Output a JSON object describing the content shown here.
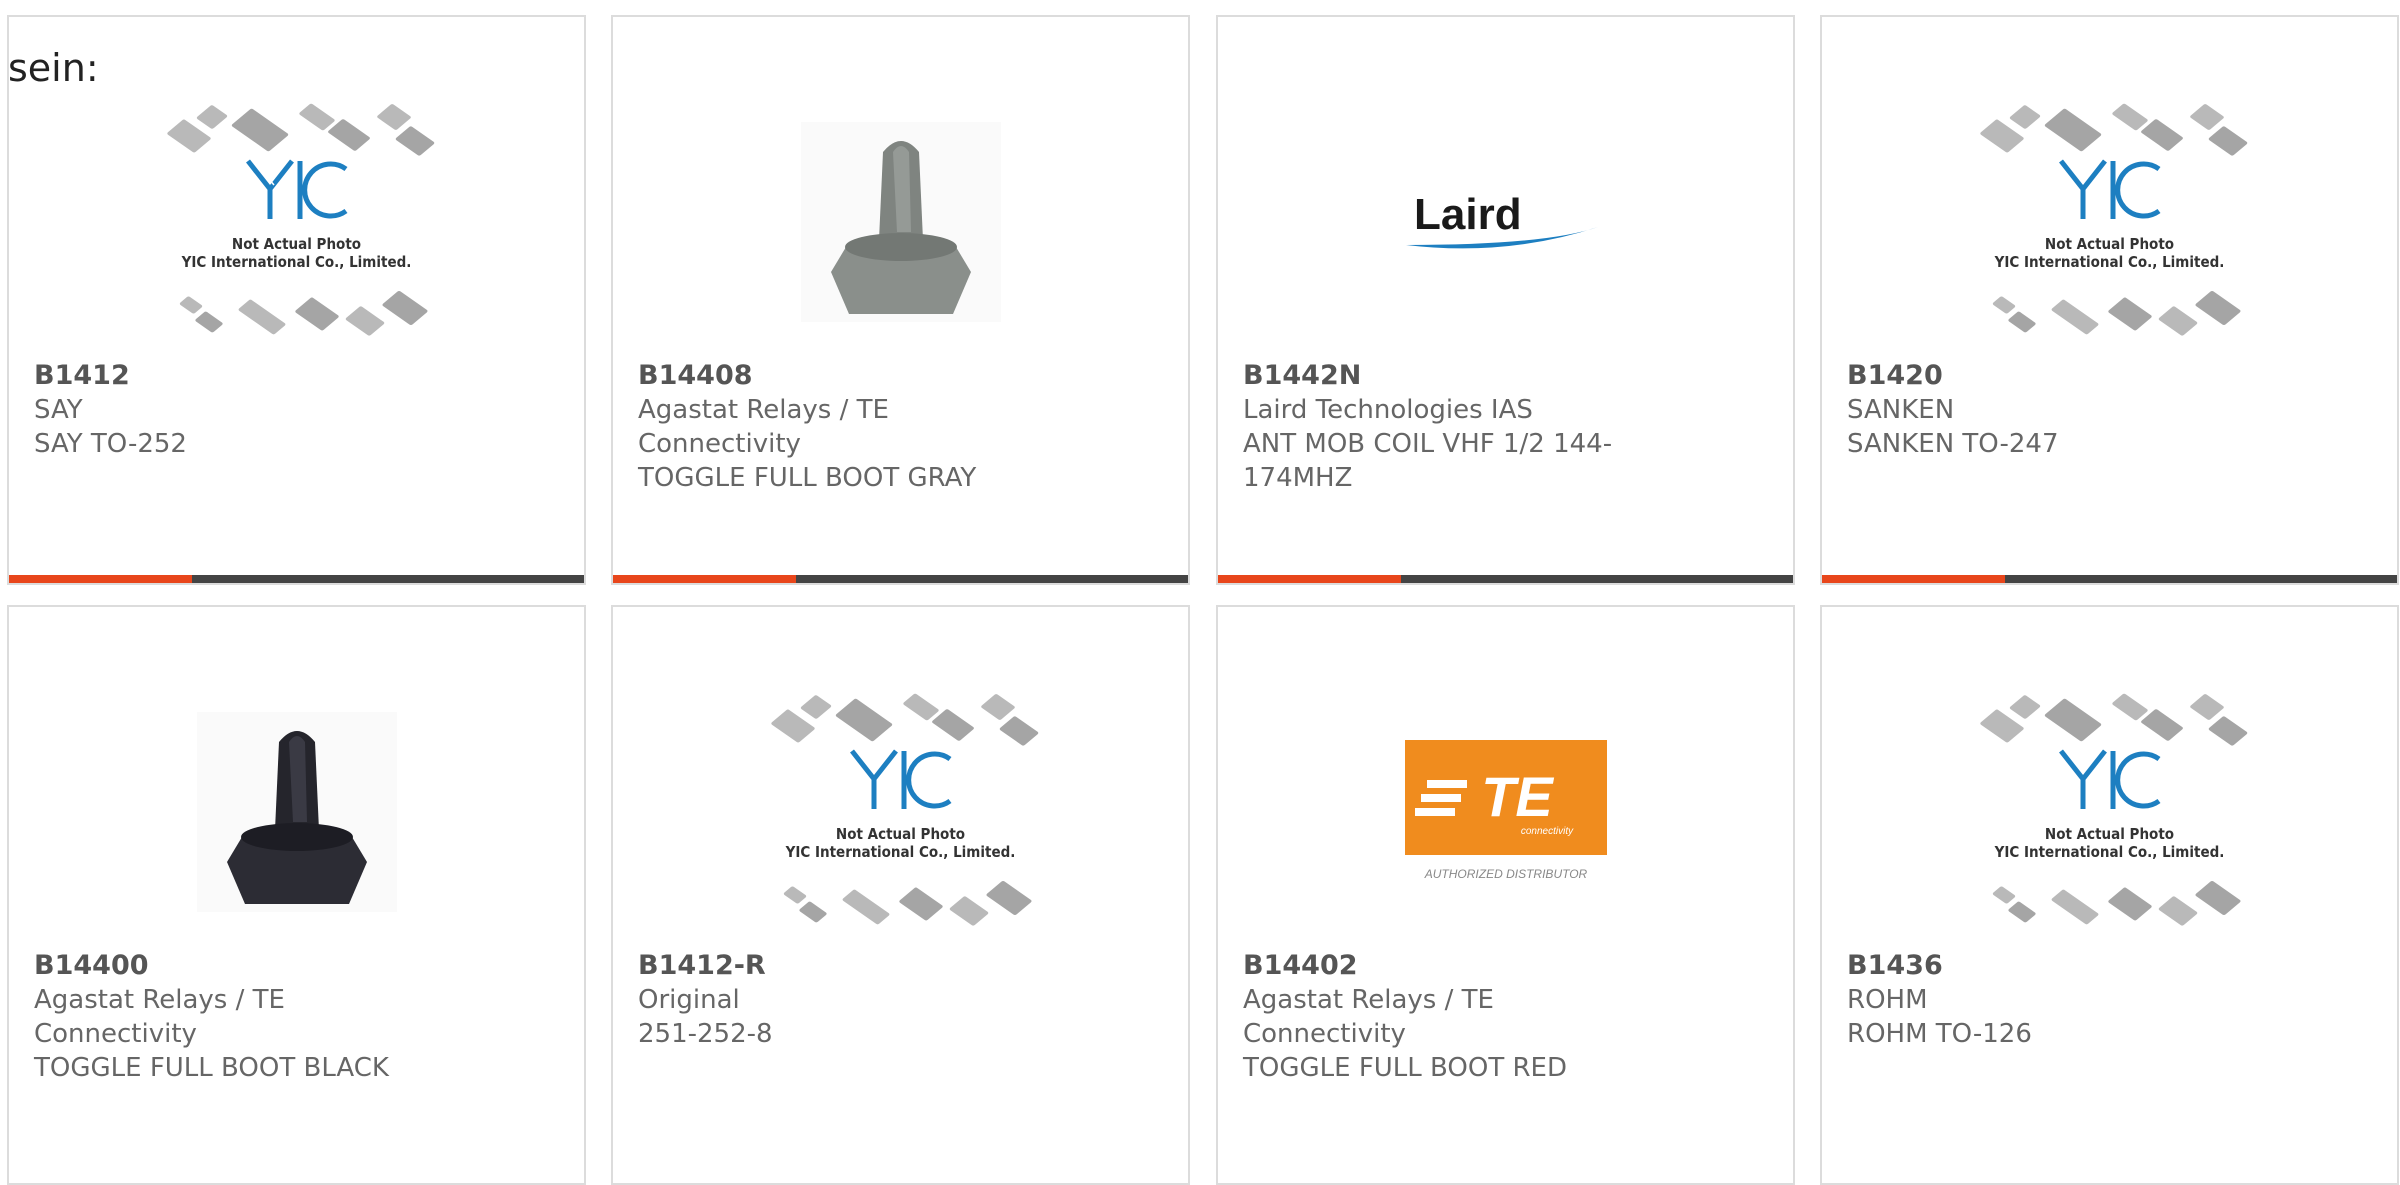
{
  "intro_text": "sein:",
  "placeholder": {
    "line1": "Not Actual Photo",
    "line2": "YIC International Co., Limited.",
    "logo": "YIC"
  },
  "logos": {
    "laird": "Laird",
    "te": "TE",
    "te_sub": "connectivity",
    "te_tag": "AUTHORIZED DISTRIBUTOR"
  },
  "colors": {
    "accent": "#e8461b",
    "bar": "#444444",
    "te_orange": "#f08c1e",
    "laird_blue": "#1d7fc1"
  },
  "products": [
    {
      "part": "B1412",
      "manufacturer": "SAY",
      "description": "SAY TO-252",
      "image": "placeholder"
    },
    {
      "part": "B14408",
      "manufacturer": "Agastat Relays / TE Connectivity",
      "description": "TOGGLE FULL BOOT GRAY",
      "image": "boot-gray"
    },
    {
      "part": "B1442N",
      "manufacturer": "Laird Technologies IAS",
      "description": "ANT MOB COIL VHF 1/2 144-174MHZ",
      "image": "laird-logo"
    },
    {
      "part": "B1420",
      "manufacturer": "SANKEN",
      "description": "SANKEN TO-247",
      "image": "placeholder"
    },
    {
      "part": "B14400",
      "manufacturer": "Agastat Relays / TE Connectivity",
      "description": "TOGGLE FULL BOOT BLACK",
      "image": "boot-black"
    },
    {
      "part": "B1412-R",
      "manufacturer": "Original",
      "description": "251-252-8",
      "image": "placeholder"
    },
    {
      "part": "B14402",
      "manufacturer": "Agastat Relays / TE Connectivity",
      "description": "TOGGLE FULL BOOT RED",
      "image": "te-logo"
    },
    {
      "part": "B1436",
      "manufacturer": "ROHM",
      "description": "ROHM TO-126",
      "image": "placeholder"
    }
  ]
}
